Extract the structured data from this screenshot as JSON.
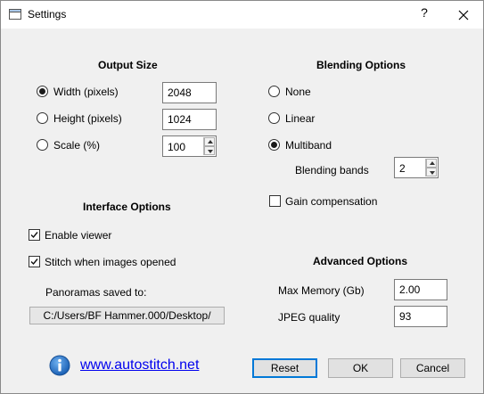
{
  "window": {
    "title": "Settings",
    "help": "?"
  },
  "output_size": {
    "title": "Output Size",
    "width_label": "Width (pixels)",
    "width_value": "2048",
    "height_label": "Height (pixels)",
    "height_value": "1024",
    "scale_label": "Scale (%)",
    "scale_value": "100",
    "selected": "width"
  },
  "blending": {
    "title": "Blending Options",
    "none_label": "None",
    "linear_label": "Linear",
    "multiband_label": "Multiband",
    "selected": "multiband",
    "bands_label": "Blending bands",
    "bands_value": "2",
    "gain_label": "Gain compensation",
    "gain_checked": false
  },
  "interface": {
    "title": "Interface Options",
    "enable_viewer_label": "Enable viewer",
    "enable_viewer_checked": true,
    "stitch_label": "Stitch when images opened",
    "stitch_checked": true,
    "saved_to_label": "Panoramas saved to:",
    "saved_path": "C:/Users/BF Hammer.000/Desktop/"
  },
  "advanced": {
    "title": "Advanced Options",
    "memory_label": "Max Memory (Gb)",
    "memory_value": "2.00",
    "jpeg_label": "JPEG quality",
    "jpeg_value": "93"
  },
  "footer": {
    "link": "www.autostitch.net",
    "reset": "Reset",
    "ok": "OK",
    "cancel": "Cancel"
  },
  "colors": {
    "accent": "#0078d7",
    "link": "#0000ee",
    "info": "#1a6fc8"
  }
}
